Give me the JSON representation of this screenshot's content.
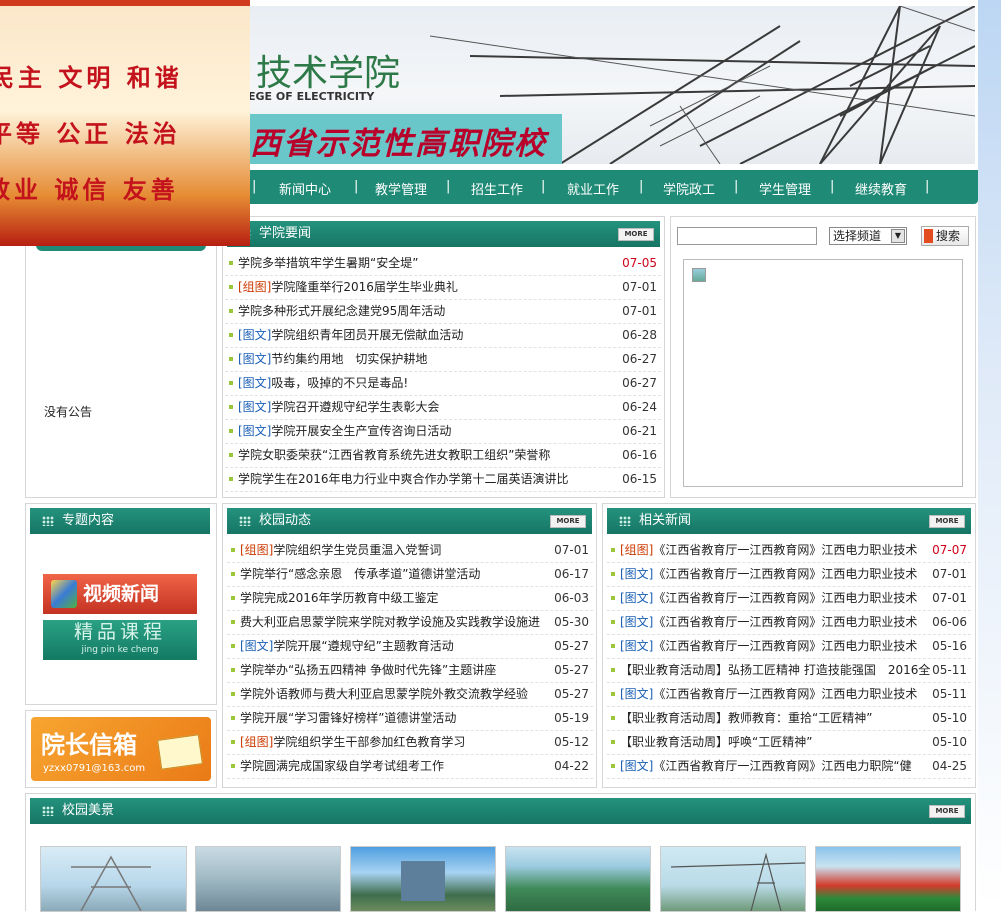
{
  "banner": {
    "school_name": "技术学院",
    "school_name_en": "EGE OF ELECTRICITY",
    "slogan": "西省示范性高职院校"
  },
  "popup_ad": {
    "rows": [
      "民主 文明 和谐",
      "平等 公正 法治",
      "敬业 诚信 友善"
    ]
  },
  "nav": {
    "items": [
      "新闻中心",
      "教学管理",
      "招生工作",
      "就业工作",
      "学院政工",
      "学生管理",
      "继续教育"
    ],
    "separator": "|"
  },
  "notice": {
    "empty_text": "没有公告"
  },
  "news": {
    "title": "学院要闻",
    "more": "MORE",
    "items": [
      {
        "tag": "",
        "text": "学院多举措筑牢学生暑期“安全堤”",
        "date": "07-05",
        "date_red": true
      },
      {
        "tag": "[组图]",
        "text": "学院隆重举行2016届学生毕业典礼",
        "date": "07-01"
      },
      {
        "tag": "",
        "text": "学院多种形式开展纪念建党95周年活动",
        "date": "07-01"
      },
      {
        "tag": "[图文]",
        "text": "学院组织青年团员开展无偿献血活动",
        "date": "06-28"
      },
      {
        "tag": "[图文]",
        "text": "节约集约用地　切实保护耕地",
        "date": "06-27"
      },
      {
        "tag": "[图文]",
        "text": "吸毒，吸掉的不只是毒品!",
        "date": "06-27"
      },
      {
        "tag": "[图文]",
        "text": "学院召开遵规守纪学生表彰大会",
        "date": "06-24"
      },
      {
        "tag": "[图文]",
        "text": "学院开展安全生产宣传咨询日活动",
        "date": "06-21"
      },
      {
        "tag": "",
        "text": "学院女职委荣获“江西省教育系统先进女教职工组织”荣誉称",
        "date": "06-16"
      },
      {
        "tag": "",
        "text": "学院学生在2016年电力行业中爽合作办学第十二届英语演讲比",
        "date": "06-15"
      }
    ]
  },
  "search": {
    "placeholder": "",
    "channel_label": "选择频道",
    "button": "搜索"
  },
  "topics": {
    "title": "专题内容",
    "video": "视频新闻",
    "course": "精品课程",
    "course_sub": "jing pin ke cheng"
  },
  "mailbox": {
    "title": "院长信箱",
    "email": "yzxx0791@163.com"
  },
  "campus": {
    "title": "校园动态",
    "more": "MORE",
    "items": [
      {
        "tag": "[组图]",
        "text": "学院组织学生党员重温入党誓词",
        "date": "07-01"
      },
      {
        "tag": "",
        "text": "学院举行“感念亲恩　传承孝道”道德讲堂活动",
        "date": "06-17"
      },
      {
        "tag": "",
        "text": "学院完成2016年学历教育中级工鉴定",
        "date": "06-03"
      },
      {
        "tag": "",
        "text": "费大利亚启思蒙学院来学院对教学设施及实践教学设施进",
        "date": "05-30"
      },
      {
        "tag": "[图文]",
        "text": "学院开展“遵规守纪”主题教育活动",
        "date": "05-27"
      },
      {
        "tag": "",
        "text": "学院举办“弘扬五四精神 争做时代先锋”主题讲座",
        "date": "05-27"
      },
      {
        "tag": "",
        "text": "学院外语教师与费大利亚启思蒙学院外教交流教学经验",
        "date": "05-27"
      },
      {
        "tag": "",
        "text": "学院开展“学习雷锋好榜样”道德讲堂活动",
        "date": "05-19"
      },
      {
        "tag": "[组图]",
        "text": "学院组织学生干部参加红色教育学习",
        "date": "05-12"
      },
      {
        "tag": "",
        "text": "学院圆满完成国家级自学考试组考工作",
        "date": "04-22"
      }
    ]
  },
  "related": {
    "title": "相关新闻",
    "more": "MORE",
    "items": [
      {
        "tag": "[组图]",
        "text": "《江西省教育厅一江西教育网》江西电力职业技术",
        "date": "07-07",
        "date_red": true
      },
      {
        "tag": "[图文]",
        "text": "《江西省教育厅一江西教育网》江西电力职业技术",
        "date": "07-01"
      },
      {
        "tag": "[图文]",
        "text": "《江西省教育厅一江西教育网》江西电力职业技术",
        "date": "07-01"
      },
      {
        "tag": "[图文]",
        "text": "《江西省教育厅一江西教育网》江西电力职业技术",
        "date": "06-06"
      },
      {
        "tag": "[图文]",
        "text": "《江西省教育厅一江西教育网》江西电力职业技术",
        "date": "05-16"
      },
      {
        "tag": "",
        "text": "【职业教育活动周】弘扬工匠精神 打造技能强国　2016全",
        "date": "05-11"
      },
      {
        "tag": "[图文]",
        "text": "《江西省教育厅一江西教育网》江西电力职业技术",
        "date": "05-11"
      },
      {
        "tag": "",
        "text": "【职业教育活动周】教师教育：重拾“工匠精神”",
        "date": "05-10"
      },
      {
        "tag": "",
        "text": "【职业教育活动周】呼唤“工匠精神”",
        "date": "05-10"
      },
      {
        "tag": "[图文]",
        "text": "《江西省教育厅一江西教育网》江西电力职院“健",
        "date": "04-25"
      }
    ]
  },
  "gallery": {
    "title": "校园美景",
    "more": "MORE"
  },
  "colors": {
    "nav_green": "#1f8a76",
    "accent_red": "#d0021b",
    "tag_blue": "#1a5fb4"
  }
}
